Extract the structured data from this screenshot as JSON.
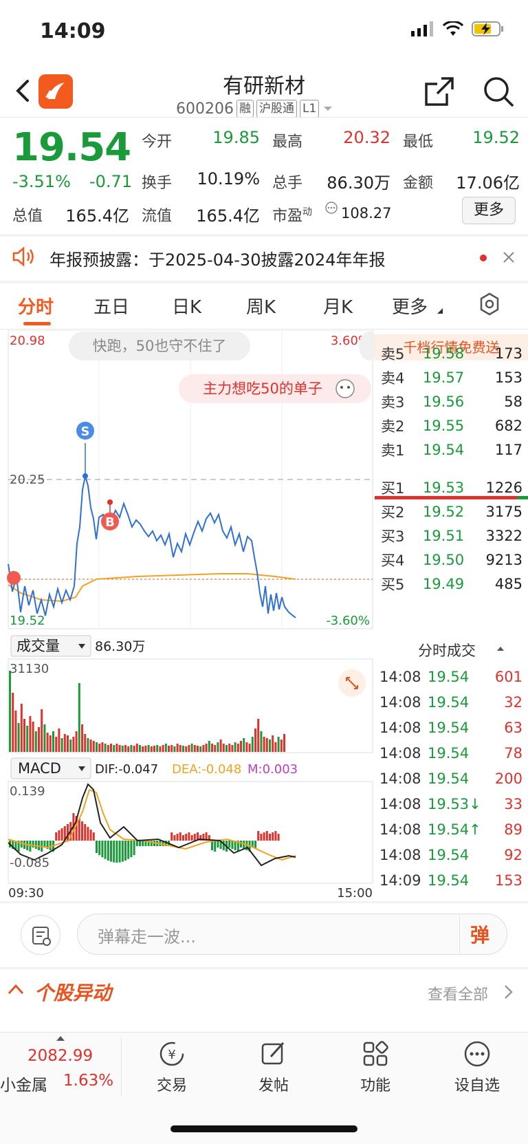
{
  "status_bar": {
    "time": "14:09"
  },
  "header": {
    "stock_name": "有研新材",
    "stock_code": "600206",
    "tags": [
      "融",
      "沪股通",
      "L1"
    ]
  },
  "quote": {
    "price": "19.54",
    "change_pct": "-3.51%",
    "change_abs": "-0.71",
    "fields": [
      {
        "label": "今开",
        "value": "19.85",
        "color": "green"
      },
      {
        "label": "最高",
        "value": "20.32",
        "color": "red"
      },
      {
        "label": "最低",
        "value": "19.52",
        "color": "green"
      },
      {
        "label": "换手",
        "value": "10.19%",
        "color": "black"
      },
      {
        "label": "总手",
        "value": "86.30万",
        "color": "black"
      },
      {
        "label": "金额",
        "value": "17.06亿",
        "color": "black"
      },
      {
        "label": "总值",
        "value": "165.4亿",
        "color": "black"
      },
      {
        "label": "流值",
        "value": "165.4亿",
        "color": "black"
      }
    ],
    "pe_label": "市盈",
    "pe_super": "动",
    "pe_value": "108.27",
    "more_label": "更多"
  },
  "notice": {
    "text": "年报预披露：于2025-04-30披露2024年年报"
  },
  "tabs": [
    "分时",
    "五日",
    "日K",
    "周K",
    "月K",
    "更多"
  ],
  "chart": {
    "price_high": "20.98",
    "price_low": "19.52",
    "pct_high": "3.60%",
    "pct_low": "-3.60%",
    "ref_line": "20.25",
    "bubble1": "快跑，50也守不住了",
    "bubble2": "主力想吃50的单子",
    "marker_s": "S",
    "marker_b": "B",
    "volume_label": "成交量",
    "volume_value": "86.30万",
    "volume_max": "31130",
    "macd_label": "MACD",
    "dif": "DIF:-0.047",
    "dea": "DEA:-0.048",
    "m": "M:0.003",
    "macd_high": "0.139",
    "macd_low": "-0.085",
    "time_start": "09:30",
    "time_end": "15:00"
  },
  "chart_data": {
    "type": "line",
    "title": "",
    "series": [],
    "y_range": [
      19.52,
      20.98
    ],
    "x_range": [
      "09:30",
      "15:00"
    ]
  },
  "orderbook": {
    "banner": "千档行情免费送",
    "asks": [
      {
        "label": "卖5",
        "price": "19.58",
        "vol": "173"
      },
      {
        "label": "卖4",
        "price": "19.57",
        "vol": "153"
      },
      {
        "label": "卖3",
        "price": "19.56",
        "vol": "58"
      },
      {
        "label": "卖2",
        "price": "19.55",
        "vol": "682"
      },
      {
        "label": "卖1",
        "price": "19.54",
        "vol": "117"
      }
    ],
    "bids": [
      {
        "label": "买1",
        "price": "19.53",
        "vol": "1226"
      },
      {
        "label": "买2",
        "price": "19.52",
        "vol": "3175"
      },
      {
        "label": "买3",
        "price": "19.51",
        "vol": "3322"
      },
      {
        "label": "买4",
        "price": "19.50",
        "vol": "9213"
      },
      {
        "label": "买5",
        "price": "19.49",
        "vol": "485"
      }
    ],
    "ticks_title": "分时成交",
    "ticks": [
      {
        "time": "14:08",
        "price": "19.54",
        "vol": "601"
      },
      {
        "time": "14:08",
        "price": "19.54",
        "vol": "32"
      },
      {
        "time": "14:08",
        "price": "19.54",
        "vol": "63"
      },
      {
        "time": "14:08",
        "price": "19.54",
        "vol": "78"
      },
      {
        "time": "14:08",
        "price": "19.54",
        "vol": "200"
      },
      {
        "time": "14:08",
        "price": "19.53↓",
        "vol": "33"
      },
      {
        "time": "14:08",
        "price": "19.54↑",
        "vol": "89"
      },
      {
        "time": "14:08",
        "price": "19.54",
        "vol": "92"
      },
      {
        "time": "14:09",
        "price": "19.54",
        "vol": "153"
      }
    ]
  },
  "comment": {
    "placeholder": "弹幕走一波...",
    "send_label": "弹"
  },
  "movement": {
    "title": "个股异动",
    "view_all": "查看全部"
  },
  "bottom_nav": {
    "index_value": "2082.99",
    "index_name": "小金属",
    "index_pct": "1.63%",
    "items": [
      "交易",
      "发帖",
      "功能",
      "设自选"
    ]
  }
}
